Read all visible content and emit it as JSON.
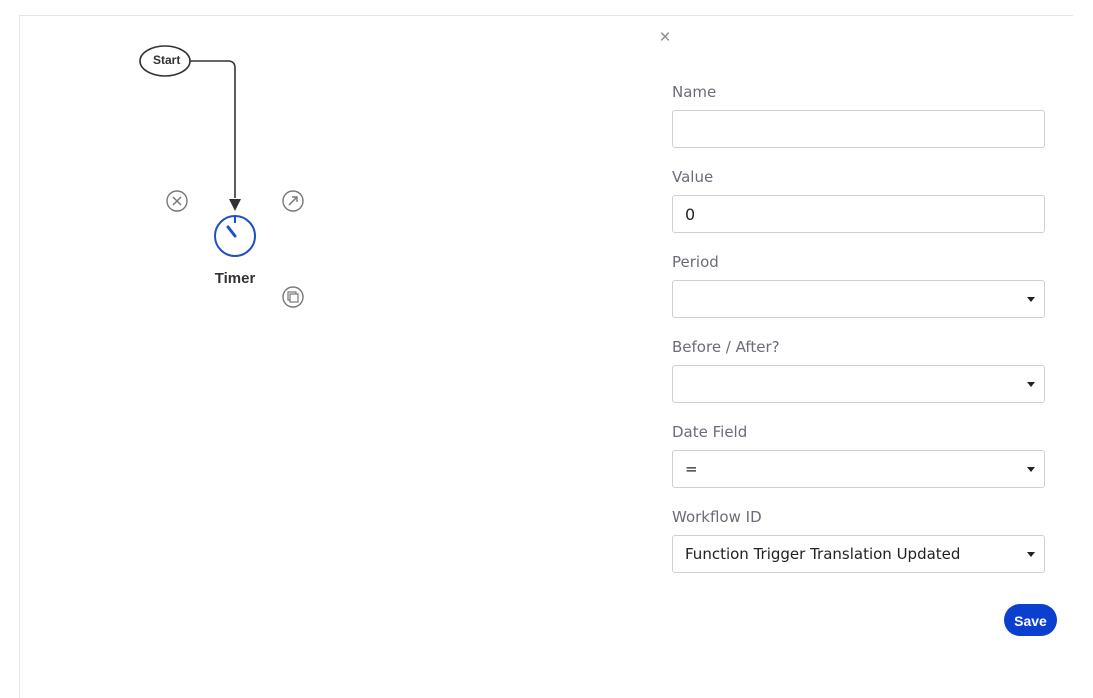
{
  "workflow": {
    "nodes": {
      "start": {
        "label": "Start"
      },
      "timer": {
        "label": "Timer",
        "icon": "timer-icon"
      }
    },
    "node_actions": [
      {
        "name": "delete-node-button",
        "icon": "close-circle-icon"
      },
      {
        "name": "open-node-button",
        "icon": "arrow-up-right-icon"
      },
      {
        "name": "duplicate-node-button",
        "icon": "copy-icon"
      }
    ]
  },
  "panel": {
    "close_icon": "close-icon",
    "close_glyph": "×",
    "fields": {
      "name": {
        "label": "Name",
        "value": ""
      },
      "value": {
        "label": "Value",
        "value": "0"
      },
      "period": {
        "label": "Period",
        "selected": ""
      },
      "before_after": {
        "label": "Before / After?",
        "selected": ""
      },
      "date_field": {
        "label": "Date Field",
        "selected": "="
      },
      "workflow_id": {
        "label": "Workflow ID",
        "selected": "Function Trigger Translation Updated"
      }
    },
    "save_label": "Save"
  },
  "colors": {
    "accent": "#0b3fd0",
    "timer_stroke": "#1f4fc8",
    "border": "#cfcfd6"
  }
}
